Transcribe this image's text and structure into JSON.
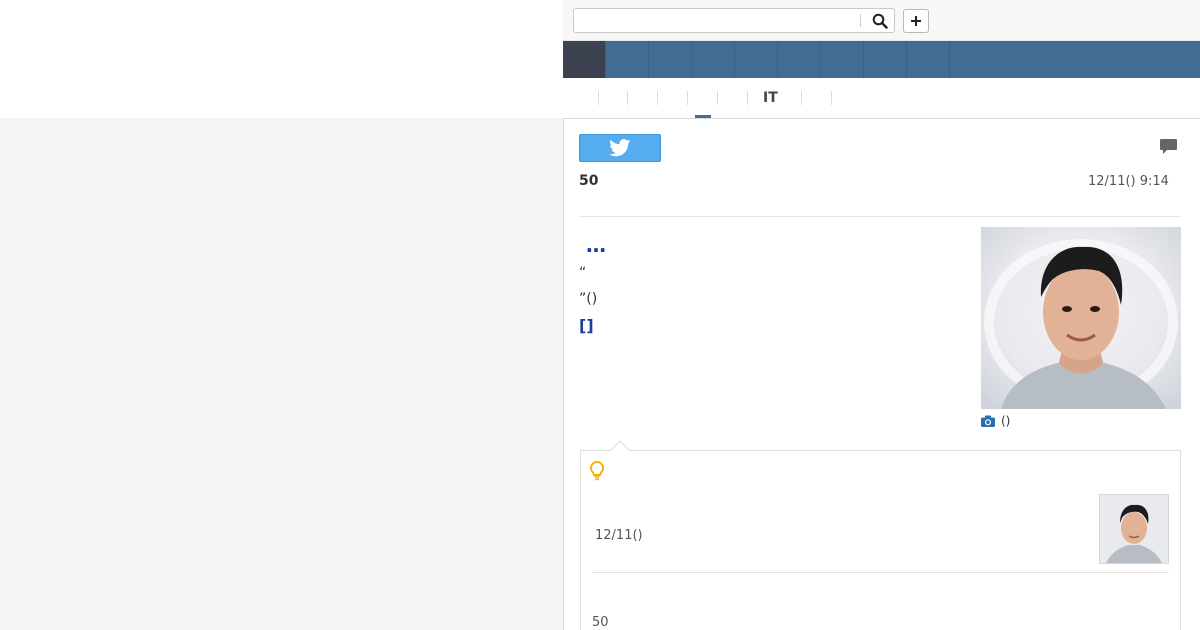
{
  "search": {
    "value": "",
    "placeholder": ""
  },
  "nav": {
    "items": [
      "",
      "",
      "",
      "",
      "",
      "",
      "",
      "",
      ""
    ]
  },
  "subnav": {
    "active_label": "IT"
  },
  "article": {
    "count": "50",
    "date": "12/11() 9:14",
    "headline": "…",
    "quote_open": "“",
    "quote_close": "”()",
    "bracket_link": "[]",
    "photo_caption": "()"
  },
  "related": {
    "date": "12/11()",
    "count": "50"
  },
  "icons": {
    "search": "search-icon",
    "plus": "plus-icon",
    "twitter": "twitter-bird-icon",
    "comment": "comment-icon",
    "camera": "camera-icon",
    "bulb": "lightbulb-icon"
  },
  "colors": {
    "nav_blue": "#436c95",
    "nav_active": "#3c4250",
    "twitter_blue": "#55acee",
    "link_blue": "#1a3d9f",
    "bulb_yellow": "#f0b400",
    "camera_blue": "#2a6fb0"
  }
}
